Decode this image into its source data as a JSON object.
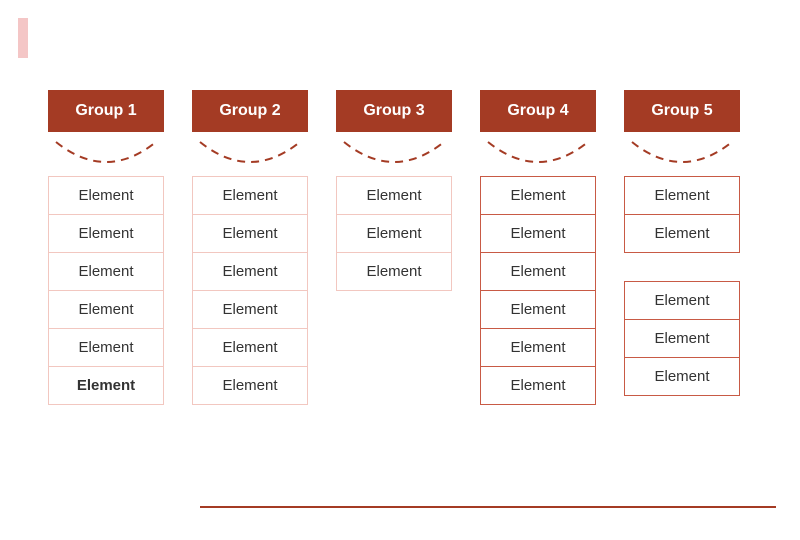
{
  "colors": {
    "brand": "#a43b24",
    "accent_light": "#f4c6c6",
    "border_light": "#f2c7c0",
    "border_strong": "#c85a45"
  },
  "groups": [
    {
      "header": "Group 1",
      "sections": [
        {
          "items": [
            {
              "label": "Element"
            },
            {
              "label": "Element"
            },
            {
              "label": "Element"
            },
            {
              "label": "Element"
            },
            {
              "label": "Element"
            },
            {
              "label": "Element",
              "bold": true
            }
          ]
        }
      ]
    },
    {
      "header": "Group 2",
      "sections": [
        {
          "items": [
            {
              "label": "Element"
            },
            {
              "label": "Element"
            },
            {
              "label": "Element"
            },
            {
              "label": "Element"
            },
            {
              "label": "Element"
            },
            {
              "label": "Element"
            }
          ]
        }
      ]
    },
    {
      "header": "Group 3",
      "sections": [
        {
          "items": [
            {
              "label": "Element"
            },
            {
              "label": "Element"
            },
            {
              "label": "Element"
            }
          ]
        }
      ]
    },
    {
      "header": "Group 4",
      "sections": [
        {
          "strong": true,
          "items": [
            {
              "label": "Element"
            },
            {
              "label": "Element"
            },
            {
              "label": "Element"
            },
            {
              "label": "Element"
            },
            {
              "label": "Element"
            },
            {
              "label": "Element"
            }
          ]
        }
      ]
    },
    {
      "header": "Group 5",
      "sections": [
        {
          "strong": true,
          "items": [
            {
              "label": "Element"
            },
            {
              "label": "Element"
            }
          ]
        },
        {
          "strong": true,
          "items": [
            {
              "label": "Element"
            },
            {
              "label": "Element"
            },
            {
              "label": "Element"
            }
          ]
        }
      ]
    }
  ]
}
